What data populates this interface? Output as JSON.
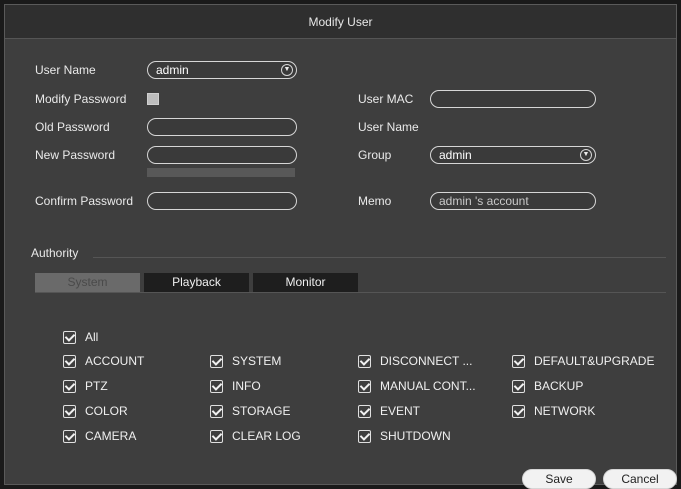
{
  "title": "Modify User",
  "left_form": {
    "user_name_label": "User Name",
    "user_name_value": "admin",
    "modify_password_label": "Modify Password",
    "old_password_label": "Old Password",
    "new_password_label": "New Password",
    "confirm_password_label": "Confirm Password"
  },
  "right_form": {
    "user_mac_label": "User MAC",
    "user_mac_value": "",
    "user_name_label": "User Name",
    "group_label": "Group",
    "group_value": "admin",
    "memo_label": "Memo",
    "memo_value": "admin 's account"
  },
  "authority": {
    "section_label": "Authority",
    "tabs": [
      {
        "label": "System"
      },
      {
        "label": "Playback"
      },
      {
        "label": "Monitor"
      }
    ],
    "permissions": {
      "all": "All",
      "col1": [
        "ACCOUNT",
        "PTZ",
        "COLOR",
        "CAMERA"
      ],
      "col2": [
        "SYSTEM",
        "INFO",
        "STORAGE",
        "CLEAR LOG"
      ],
      "col3": [
        "DISCONNECT ...",
        "MANUAL CONT...",
        "EVENT",
        "SHUTDOWN"
      ],
      "col4": [
        "DEFAULT&UPGRADE",
        "BACKUP",
        "NETWORK"
      ]
    }
  },
  "buttons": {
    "save": "Save",
    "cancel": "Cancel"
  }
}
